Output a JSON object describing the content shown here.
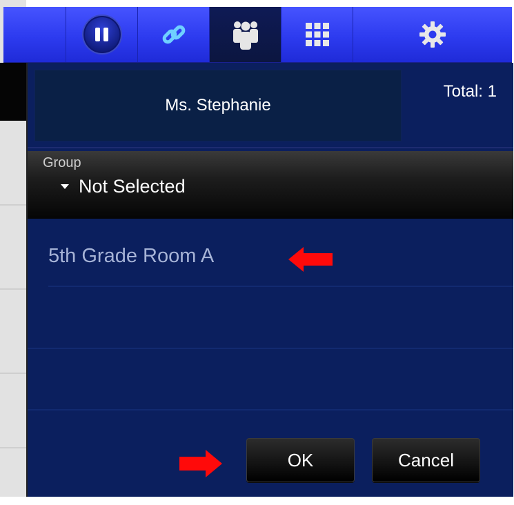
{
  "toolbar": {
    "buttons": [
      {
        "icon": "pause-icon"
      },
      {
        "icon": "link-icon"
      },
      {
        "icon": "group-people-icon",
        "active": true
      },
      {
        "icon": "grid-icon"
      },
      {
        "icon": "gear-icon"
      }
    ],
    "colors": {
      "bar": "#2d3bef",
      "active": "#0c1640",
      "link": "#6fd0ff"
    }
  },
  "dialog": {
    "name": "Ms. Stephanie",
    "total": "Total: 1",
    "group": {
      "label": "Group",
      "selected": "Not Selected"
    },
    "items": [
      {
        "label": "5th Grade Room A"
      }
    ],
    "buttons": {
      "ok": "OK",
      "cancel": "Cancel"
    },
    "colors": {
      "background": "#0b1f5e",
      "annotation_arrow": "#ff0a0a"
    }
  }
}
